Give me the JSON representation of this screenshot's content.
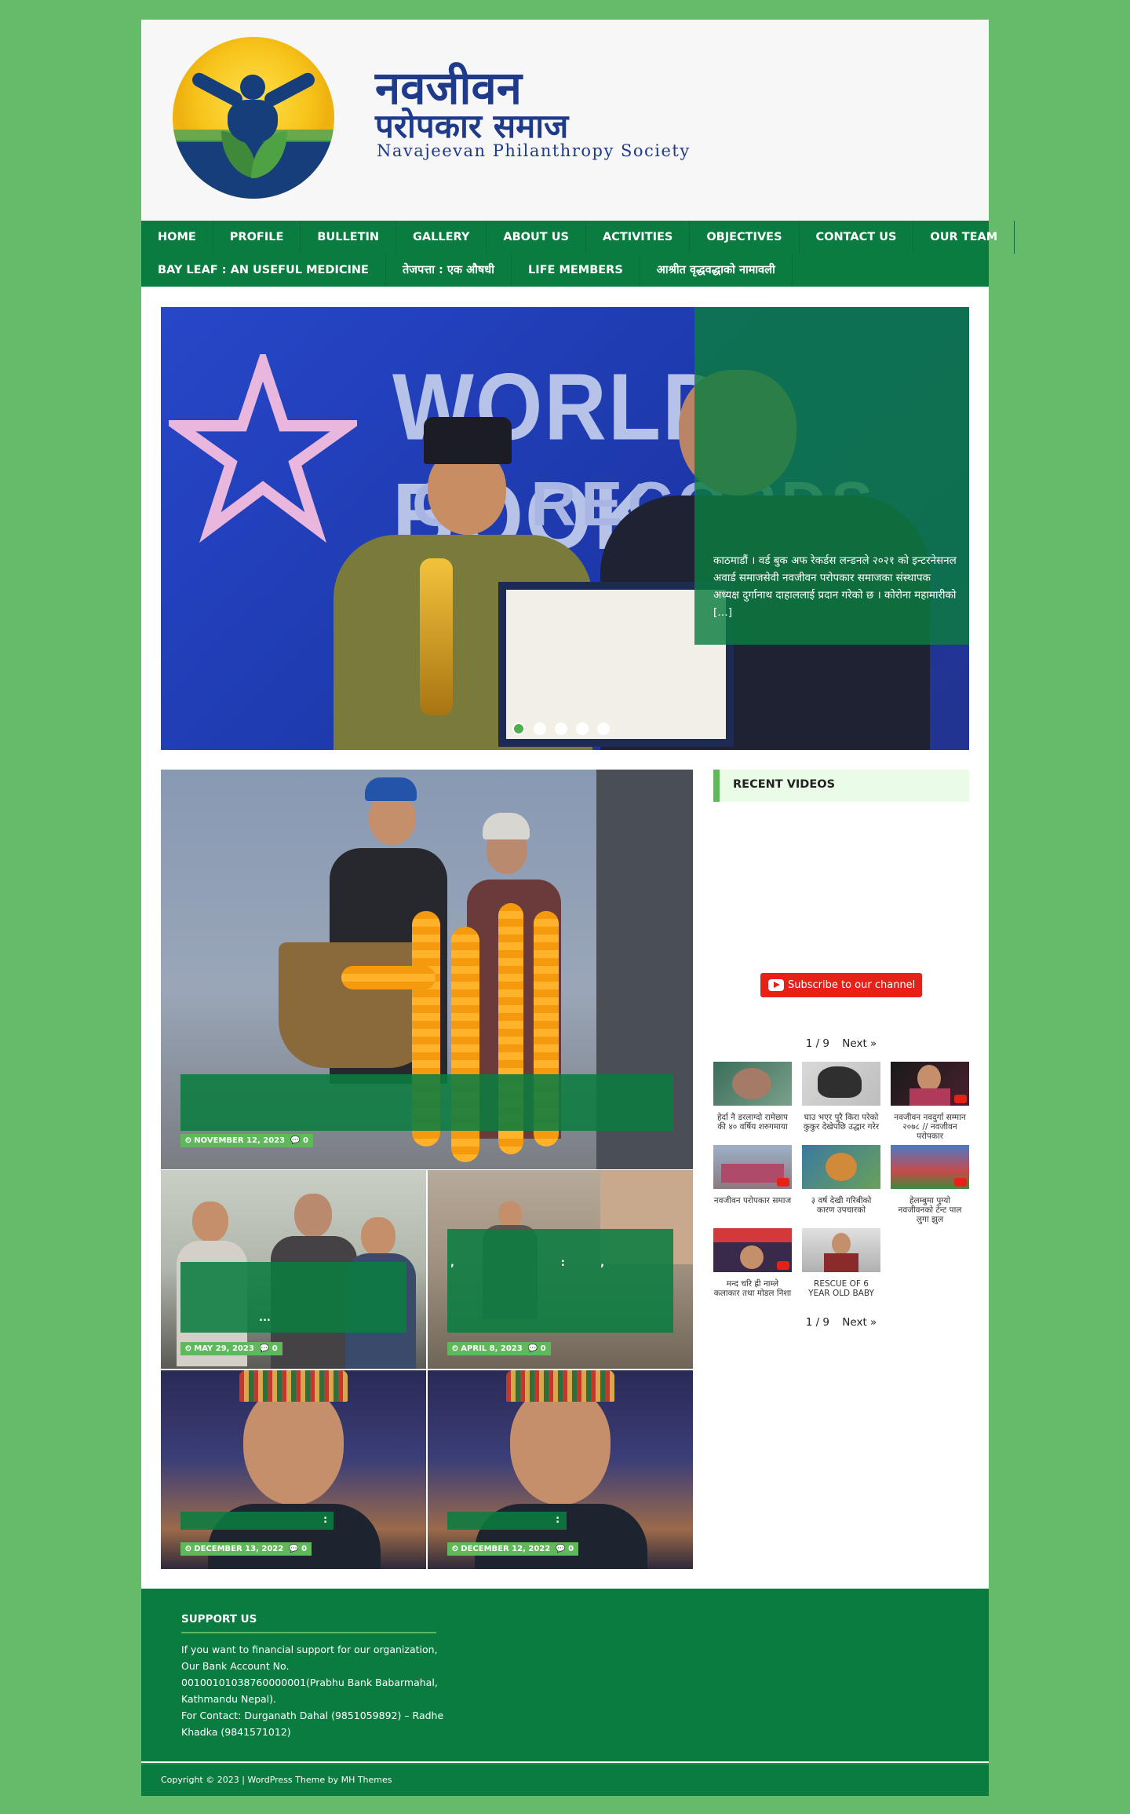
{
  "site": {
    "title_nepali_1": "नवजीवन",
    "title_nepali_2": "परोपकार समाज",
    "title_english": "Navajeevan Philanthropy Society"
  },
  "nav": {
    "row1": [
      "HOME",
      "PROFILE",
      "BULLETIN",
      "GALLERY",
      "ABOUT US",
      "ACTIVITIES",
      "OBJECTIVES",
      "CONTACT US",
      "OUR TEAM"
    ],
    "row2": [
      "BAY LEAF : AN USEFUL MEDICINE",
      "तेजपत्ता : एक औषधी",
      "LIFE MEMBERS",
      "आश्रीत वृद्धवद्धाको नामावली"
    ]
  },
  "slider": {
    "excerpt": "काठमाडौं । वर्ड बुक अफ रेकर्डस लन्डनले २०२१ को इन्टरनेसनल अवार्ड समाजसेवी नवजीवन परोपकार समाजका संस्थापक अध्यक्ष दुर्गानाथ दाहाललाई प्रदान गरेको छ । कोरोना महामारीको […]",
    "slide_count": 5,
    "active_slide": 1,
    "backdrop_text_1": "WORLD BOOK",
    "backdrop_text_2": "OF RECORDS"
  },
  "posts": [
    {
      "date": "NOVEMBER 12, 2023",
      "comments": "0",
      "title": ""
    },
    {
      "date": "MAY 29, 2023",
      "comments": "0",
      "title": "..."
    },
    {
      "date": "APRIL 8, 2023",
      "comments": "0",
      "title": ",                              :          ,"
    },
    {
      "date": "DECEMBER 13, 2022",
      "comments": "0",
      "title": ":"
    },
    {
      "date": "DECEMBER 12, 2022",
      "comments": "0",
      "title": ":"
    }
  ],
  "sidebar": {
    "widget_title": "RECENT VIDEOS",
    "subscribe_label": "Subscribe to our channel",
    "pager_top": "1 / 9",
    "pager_bottom": "1 / 9",
    "next_label": "Next »",
    "videos": [
      {
        "title": "हेर्दा नै डरलाग्दो रामेछाप की ४० वर्षिय शरुगमाया"
      },
      {
        "title": "घाउ भएर पुरै किरा परेको कुकुर देखेपछि उद्धार गरेर"
      },
      {
        "title": "नवजीवन नवदुर्गा सम्मान २०७८ // नवजीवन परोपकार"
      },
      {
        "title": "नवजीवन परोपकार समाज"
      },
      {
        "title": "३ वर्ष देखी गरिबीको कारण उपचारको"
      },
      {
        "title": "हेलम्बुमा पुग्यो नवजीवनको टेन्ट पाल लुगा झुल"
      },
      {
        "title": "मन्द चरि ह्री नाम्ले कलाकार तथा मोडल निशा"
      },
      {
        "title": "RESCUE OF 6 YEAR OLD BABY"
      }
    ]
  },
  "footer": {
    "heading": "SUPPORT US",
    "line1": "If you want to financial support for our organization,",
    "line2": "Our Bank Account No.",
    "line3": "00100101038760000001(Prabhu Bank Babarmahal,",
    "line4": "Kathmandu Nepal).",
    "line5": "For Contact: Durganath Dahal (9851059892) – Radhe",
    "line6": "Khadka (9841571012)",
    "copyright": "Copyright © 2023 | WordPress Theme by MH Themes"
  },
  "colors": {
    "page_bg": "#66bb6a",
    "nav_bg": "#0b7c40",
    "accent": "#5fb85a",
    "brand_blue": "#1e3a8a"
  }
}
